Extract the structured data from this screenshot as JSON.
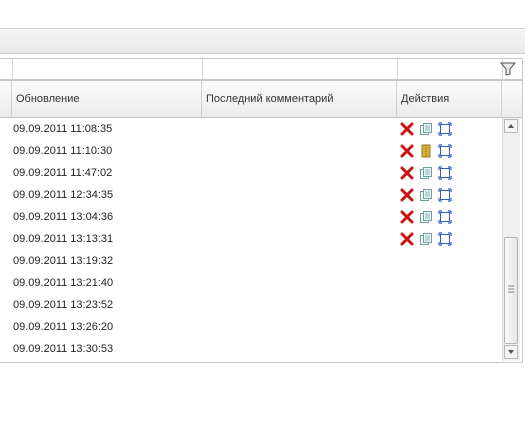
{
  "grid": {
    "columns": {
      "update": "Обновление",
      "last_comment": "Последний комментарий",
      "actions": "Действия"
    },
    "rows": [
      {
        "updated": "09.09.2011 11:08:35",
        "actions": [
          "delete-icon",
          "copy-icon",
          "expand-icon"
        ]
      },
      {
        "updated": "09.09.2011 11:10:30",
        "actions": [
          "delete-icon",
          "archive-icon",
          "expand-icon"
        ]
      },
      {
        "updated": "09.09.2011 11:47:02",
        "actions": [
          "delete-icon",
          "copy-icon",
          "expand-icon"
        ]
      },
      {
        "updated": "09.09.2011 12:34:35",
        "actions": [
          "delete-icon",
          "copy-icon",
          "expand-icon"
        ]
      },
      {
        "updated": "09.09.2011 13:04:36",
        "actions": [
          "delete-icon",
          "copy-icon",
          "expand-icon"
        ]
      },
      {
        "updated": "09.09.2011 13:13:31",
        "actions": [
          "delete-icon",
          "copy-icon",
          "expand-icon"
        ]
      },
      {
        "updated": "09.09.2011 13:19:32",
        "actions": []
      },
      {
        "updated": "09.09.2011 13:21:40",
        "actions": []
      },
      {
        "updated": "09.09.2011 13:23:52",
        "actions": []
      },
      {
        "updated": "09.09.2011 13:26:20",
        "actions": []
      },
      {
        "updated": "09.09.2011 13:30:53",
        "actions": []
      }
    ]
  },
  "colors": {
    "delete": "#cc1111",
    "copy": "#6f9fa0",
    "archive": "#d4b03a",
    "expand": "#2f5fbf"
  }
}
